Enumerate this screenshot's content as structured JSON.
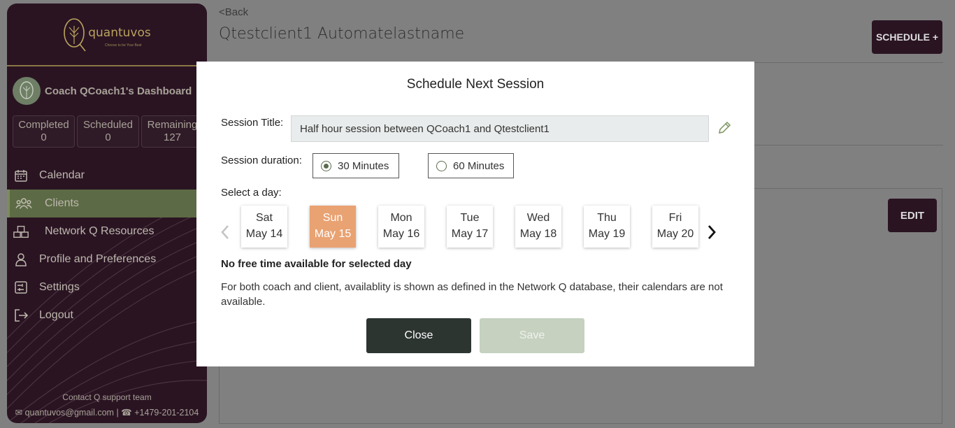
{
  "sidebar": {
    "brand": "quantuvos",
    "tagline": "Choose to be Your Best",
    "dashboard_title": "Coach QCoach1's Dashboard",
    "stats": [
      {
        "label": "Completed",
        "value": "0"
      },
      {
        "label": "Scheduled",
        "value": "0"
      },
      {
        "label": "Remaining",
        "value": "127"
      }
    ],
    "nav": [
      {
        "label": "Calendar",
        "icon": "calendar-icon"
      },
      {
        "label": "Clients",
        "icon": "users-icon",
        "active": true
      },
      {
        "label": "Network Q Resources",
        "icon": "boxes-icon"
      },
      {
        "label": "Profile and Preferences",
        "icon": "person-icon"
      },
      {
        "label": "Settings",
        "icon": "settings-icon"
      },
      {
        "label": "Logout",
        "icon": "logout-icon"
      }
    ],
    "contact_title": "Contact Q support team",
    "contact_email": "quantuvos@gmail.com",
    "contact_separator": "|",
    "contact_phone": "+1479-201-2104"
  },
  "main": {
    "back_label": "<Back",
    "client_name": "Qtestclient1 Automatelastname",
    "schedule_button": "SCHEDULE +",
    "edit_button": "EDIT"
  },
  "modal": {
    "title": "Schedule Next Session",
    "session_title_label": "Session Title:",
    "session_title_value": "Half hour session between QCoach1 and Qtestclient1",
    "duration_label": "Session duration:",
    "durations": [
      {
        "label": "30 Minutes",
        "selected": true
      },
      {
        "label": "60 Minutes",
        "selected": false
      }
    ],
    "select_day_label": "Select a day:",
    "days": [
      {
        "day": "Sat",
        "date": "May 14"
      },
      {
        "day": "Sun",
        "date": "May 15",
        "selected": true
      },
      {
        "day": "Mon",
        "date": "May 16"
      },
      {
        "day": "Tue",
        "date": "May 17"
      },
      {
        "day": "Wed",
        "date": "May 18"
      },
      {
        "day": "Thu",
        "date": "May 19"
      },
      {
        "day": "Fri",
        "date": "May 20"
      }
    ],
    "no_time_text": "No free time available for selected day",
    "note_text": "For both coach and client, availablity is shown as defined in the Network Q database, their calendars are not available.",
    "close_button": "Close",
    "save_button": "Save"
  },
  "colors": {
    "sidebar_bg": "#2a1422",
    "active_nav": "#5c6a45",
    "selected_day": "#e9a272",
    "close_button": "#2d3531",
    "save_button_disabled": "#c6d1c0",
    "overlay": "#808080"
  }
}
